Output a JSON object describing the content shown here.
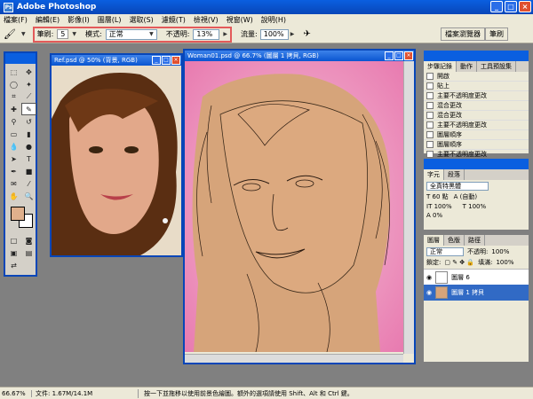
{
  "app": {
    "title": "Adobe Photoshop"
  },
  "menu": [
    "檔案(F)",
    "編輯(E)",
    "影像(I)",
    "圖層(L)",
    "選取(S)",
    "濾鏡(T)",
    "檢視(V)",
    "視窗(W)",
    "說明(H)"
  ],
  "options": {
    "brush_label": "筆刷:",
    "brush_size": "5",
    "mode_label": "模式:",
    "mode_value": "正常",
    "opacity_label": "不透明:",
    "opacity_value": "13%",
    "flow_label": "流量:",
    "flow_value": "100%"
  },
  "palette_well": {
    "tab1": "檔案瀏覽器",
    "tab2": "筆刷"
  },
  "docs": {
    "ref_title": "Ref.psd @ 50% (背景, RGB)",
    "main_title": "Woman01.psd @ 66.7% (圖層 1 拷貝, RGB)"
  },
  "history": {
    "tabs": [
      "步驟記錄",
      "動作",
      "工具預設集"
    ],
    "items": [
      "開啟",
      "貼上",
      "主要不透明度更改",
      "混合更改",
      "混合更改",
      "主要不透明度更改",
      "圖層順序",
      "圖層順序",
      "主要不透明度更改"
    ]
  },
  "character": {
    "tabs": [
      "字元",
      "段落"
    ],
    "font": "全真特黑體",
    "size": "60 點",
    "leading": "(自動)",
    "scale_v": "100%",
    "scale_h": "100%",
    "tracking": "0%"
  },
  "layers": {
    "tabs": [
      "圖層",
      "色版",
      "路徑"
    ],
    "blend": "正常",
    "opacity_label": "不透明:",
    "opacity": "100%",
    "lock_label": "鎖定:",
    "fill_label": "填滿:",
    "fill": "100%",
    "items": [
      "圖層 6",
      "圖層 1 拷貝"
    ]
  },
  "status": {
    "zoom": "66.67%",
    "doc": "文件: 1.67M/14.1M",
    "hint": "按一下並拖移以使用前景色繪圖。額外的選項請使用 Shift、Alt 和 Ctrl 鍵。"
  },
  "colors": {
    "accent": "#0846b8",
    "fg": "#e0b08c",
    "bg": "#ffffff"
  }
}
